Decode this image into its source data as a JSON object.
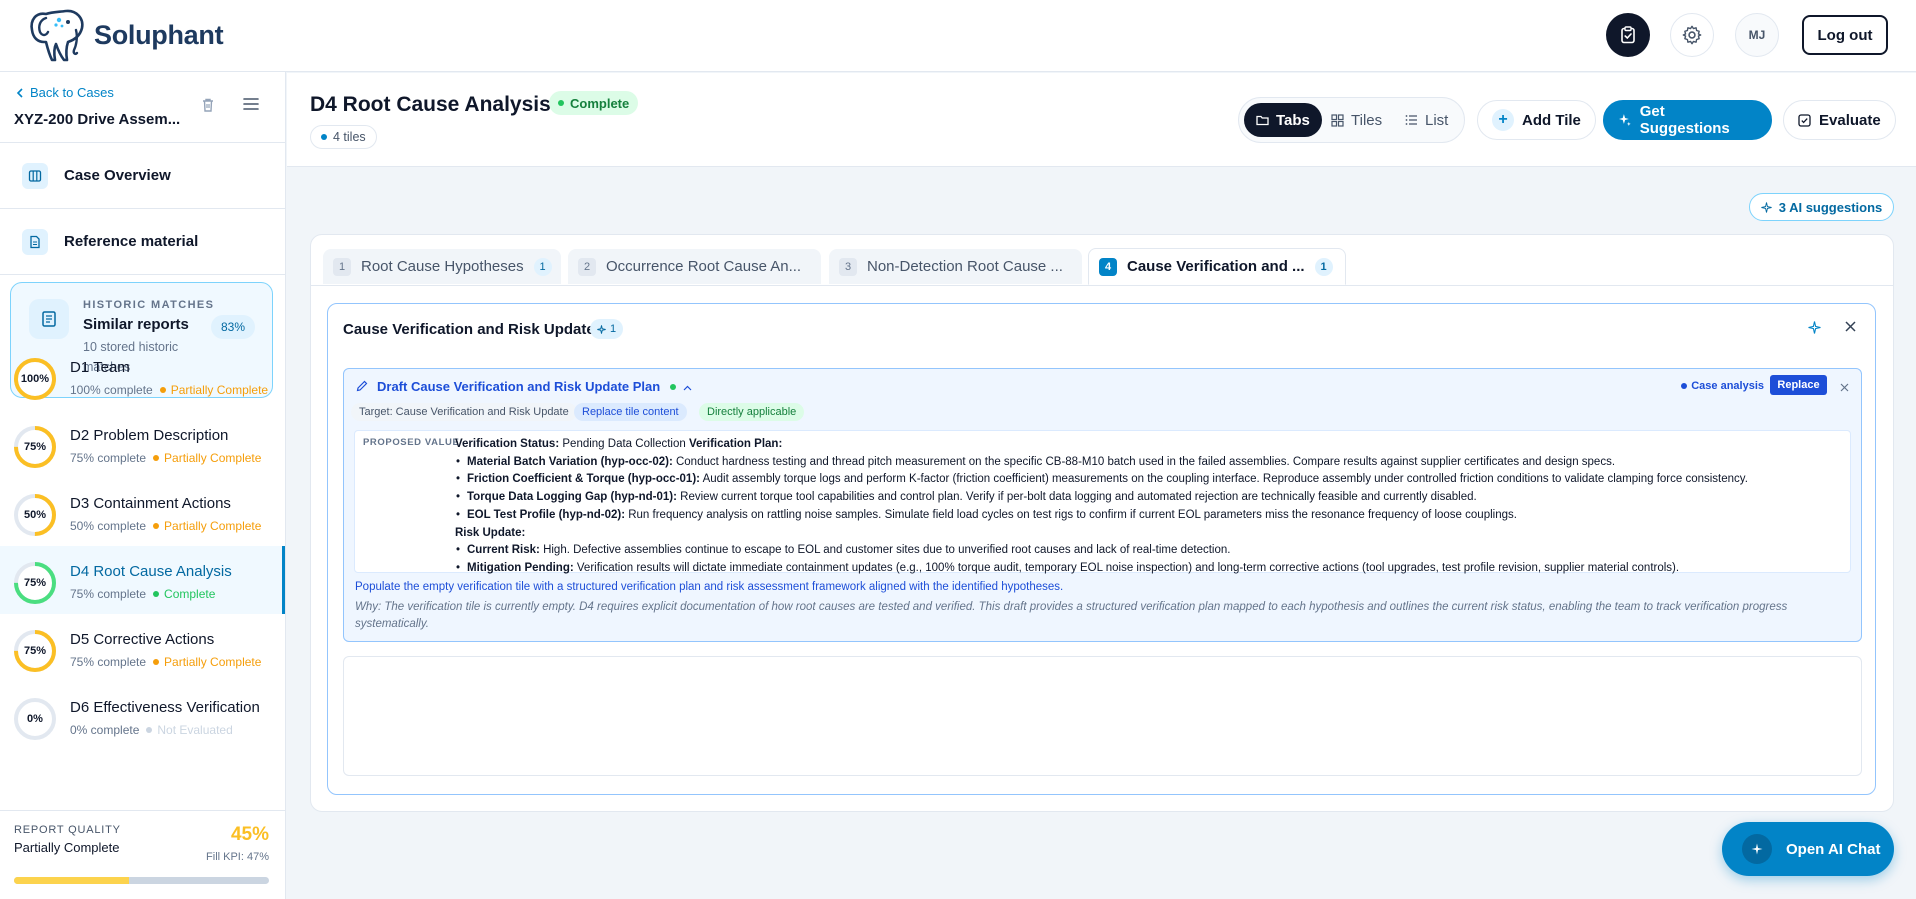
{
  "brand": {
    "name": "Soluphant"
  },
  "topbar": {
    "avatar_initials": "MJ",
    "logout_label": "Log out"
  },
  "sidebar": {
    "back_label": "Back to Cases",
    "case_name": "XYZ-200 Drive Assem...",
    "nav": [
      {
        "label": "Case Overview"
      },
      {
        "label": "Reference material"
      }
    ],
    "historic": {
      "eyebrow": "HISTORIC MATCHES",
      "title": "Similar reports",
      "subtitle": "10 stored historic matches",
      "percent": "83%"
    },
    "disciplines": [
      {
        "label": "D1 Team",
        "ring": "100%",
        "progress": "100% complete",
        "status": "Partially Complete",
        "ring_color": "#fbbf24",
        "status_color": "#f59e0b",
        "fraction": 1.0
      },
      {
        "label": "D2 Problem Description",
        "ring": "75%",
        "progress": "75% complete",
        "status": "Partially Complete",
        "ring_color": "#fbbf24",
        "status_color": "#f59e0b",
        "fraction": 0.75
      },
      {
        "label": "D3 Containment Actions",
        "ring": "50%",
        "progress": "50% complete",
        "status": "Partially Complete",
        "ring_color": "#fbbf24",
        "status_color": "#f59e0b",
        "fraction": 0.5
      },
      {
        "label": "D4 Root Cause Analysis",
        "ring": "75%",
        "progress": "75% complete",
        "status": "Complete",
        "ring_color": "#4ade80",
        "status_color": "#22c55e",
        "fraction": 0.75
      },
      {
        "label": "D5 Corrective Actions",
        "ring": "75%",
        "progress": "75% complete",
        "status": "Partially Complete",
        "ring_color": "#fbbf24",
        "status_color": "#f59e0b",
        "fraction": 0.75
      },
      {
        "label": "D6 Effectiveness Verification",
        "ring": "0%",
        "progress": "0% complete",
        "status": "Not Evaluated",
        "ring_color": "#cbd5e1",
        "status_color": "#cbd5e1",
        "fraction": 0
      }
    ],
    "quality": {
      "label": "REPORT QUALITY",
      "status": "Partially Complete",
      "percent": "45%",
      "kpi": "Fill KPI: 47%",
      "fraction": 0.45
    }
  },
  "header": {
    "title": "D4 Root Cause Analysis",
    "status_badge": "Complete",
    "tiles_count": "4 tiles",
    "views": [
      "Tabs",
      "Tiles",
      "List"
    ],
    "add_tile": "Add Tile",
    "get_suggestions": "Get Suggestions",
    "evaluate": "Evaluate"
  },
  "ai_suggestions_label": "3 AI suggestions",
  "tabs": [
    {
      "num": "1",
      "label": "Root Cause Hypotheses",
      "count": "1"
    },
    {
      "num": "2",
      "label": "Occurrence Root Cause An...",
      "count": ""
    },
    {
      "num": "3",
      "label": "Non-Detection Root Cause ...",
      "count": ""
    },
    {
      "num": "4",
      "label": "Cause Verification and ...",
      "count": "1"
    }
  ],
  "tile": {
    "title": "Cause Verification and Risk Update",
    "badge_count": "1",
    "suggestion": {
      "title": "Draft Cause Verification and Risk Update Plan",
      "source": "Case analysis",
      "replace": "Replace",
      "target": "Target: Cause Verification and Risk Update",
      "tag_replace": "Replace tile content",
      "tag_applicable": "Directly applicable",
      "pv_label": "PROPOSED VALUE",
      "status_label": "Verification Status:",
      "status_value": "Pending Data Collection",
      "plan_label": "Verification Plan:",
      "plan": [
        {
          "k": "Material Batch Variation (hyp-occ-02):",
          "v": "Conduct hardness testing and thread pitch measurement on the specific CB-88-M10 batch used in the failed assemblies. Compare results against supplier certificates and design specs."
        },
        {
          "k": "Friction Coefficient & Torque (hyp-occ-01):",
          "v": "Audit assembly torque logs and perform K-factor (friction coefficient) measurements on the coupling interface. Reproduce assembly under controlled friction conditions to validate clamping force consistency."
        },
        {
          "k": "Torque Data Logging Gap (hyp-nd-01):",
          "v": "Review current torque tool capabilities and control plan. Verify if per-bolt data logging and automated rejection are technically feasible and currently disabled."
        },
        {
          "k": "EOL Test Profile (hyp-nd-02):",
          "v": "Run frequency analysis on rattling noise samples. Simulate field load cycles on test rigs to confirm if current EOL parameters miss the resonance frequency of loose couplings."
        }
      ],
      "risk_label": "Risk Update:",
      "risk": [
        {
          "k": "Current Risk:",
          "v": "High. Defective assemblies continue to escape to EOL and customer sites due to unverified root causes and lack of real-time detection."
        },
        {
          "k": "Mitigation Pending:",
          "v": "Verification results will dictate immediate containment updates (e.g., 100% torque audit, temporary EOL noise inspection) and long-term corrective actions (tool upgrades, test profile revision, supplier material controls)."
        }
      ],
      "description": "Populate the empty verification tile with a structured verification plan and risk assessment framework aligned with the identified hypotheses.",
      "why": "Why: The verification tile is currently empty. D4 requires explicit documentation of how root causes are tested and verified. This draft provides a structured verification plan mapped to each hypothesis and outlines the current risk status, enabling the team to track verification progress systematically."
    }
  },
  "chat": {
    "label": "Open AI Chat"
  }
}
